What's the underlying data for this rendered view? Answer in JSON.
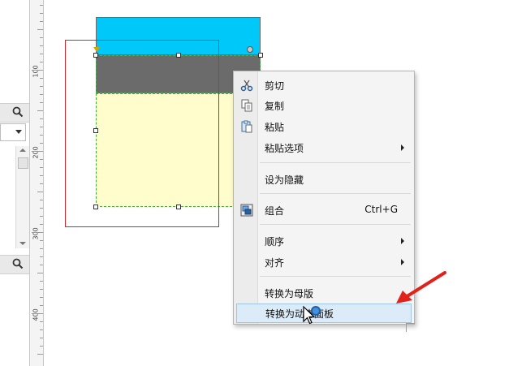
{
  "ruler": {
    "labels": [
      "100",
      "200",
      "300",
      "400"
    ]
  },
  "context_menu": {
    "items": [
      {
        "label": "剪切",
        "icon": "scissors-icon"
      },
      {
        "label": "复制",
        "icon": "copy-icon"
      },
      {
        "label": "粘贴",
        "icon": "paste-icon"
      },
      {
        "label": "粘贴选项",
        "submenu": true
      },
      {
        "label": "设为隐藏"
      },
      {
        "label": "组合",
        "icon": "group-icon",
        "shortcut": "Ctrl+G"
      },
      {
        "label": "顺序",
        "submenu": true
      },
      {
        "label": "对齐",
        "submenu": true
      },
      {
        "label": "转换为母版"
      },
      {
        "label": "转换为动态面板",
        "highlighted": true
      }
    ]
  },
  "colors": {
    "blue_shape": "#00c8f8",
    "gray_shape": "#6b6b6b",
    "yellow_shape": "#fffdcc",
    "red_frame": "#d0282e",
    "annotation_arrow": "#e0221b",
    "menu_highlight": "#dbecf8"
  }
}
